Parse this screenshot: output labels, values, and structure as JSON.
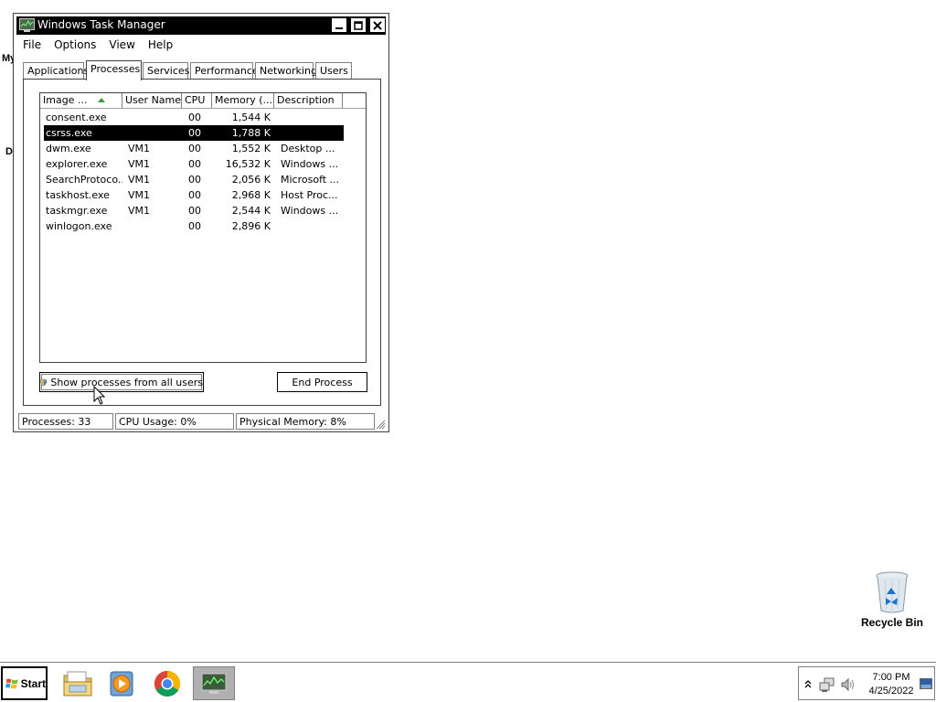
{
  "desktop": {
    "fragments": [
      "My",
      "D"
    ],
    "recycle_bin_label": "Recycle Bin"
  },
  "window": {
    "title": "Windows Task Manager",
    "icon": "task-manager-icon",
    "controls": {
      "minimize": "minimize-icon",
      "maximize": "maximize-icon",
      "close": "close-icon"
    }
  },
  "menu": [
    "File",
    "Options",
    "View",
    "Help"
  ],
  "tabs": [
    "Applications",
    "Processes",
    "Services",
    "Performance",
    "Networking",
    "Users"
  ],
  "active_tab": "Processes",
  "columns": [
    "Image ...",
    "User Name",
    "CPU",
    "Memory (...",
    "Description"
  ],
  "processes": [
    {
      "name": "consent.exe",
      "user": "",
      "cpu": "00",
      "memory": "1,544 K",
      "description": ""
    },
    {
      "name": "csrss.exe",
      "user": "",
      "cpu": "00",
      "memory": "1,788 K",
      "description": ""
    },
    {
      "name": "dwm.exe",
      "user": "VM1",
      "cpu": "00",
      "memory": "1,552 K",
      "description": "Desktop ..."
    },
    {
      "name": "explorer.exe",
      "user": "VM1",
      "cpu": "00",
      "memory": "16,532 K",
      "description": "Windows ..."
    },
    {
      "name": "SearchProtoco...",
      "user": "VM1",
      "cpu": "00",
      "memory": "2,056 K",
      "description": "Microsoft ..."
    },
    {
      "name": "taskhost.exe",
      "user": "VM1",
      "cpu": "00",
      "memory": "2,968 K",
      "description": "Host Proc..."
    },
    {
      "name": "taskmgr.exe",
      "user": "VM1",
      "cpu": "00",
      "memory": "2,544 K",
      "description": "Windows ..."
    },
    {
      "name": "winlogon.exe",
      "user": "",
      "cpu": "00",
      "memory": "2,896 K",
      "description": ""
    }
  ],
  "selected_process": "csrss.exe",
  "buttons": {
    "show_all": "Show processes from all users",
    "end_process": "End Process"
  },
  "status": {
    "processes": "Processes: 33",
    "cpu": "CPU Usage: 0%",
    "memory": "Physical Memory: 8%"
  },
  "taskbar": {
    "start_label": "Start",
    "apps": [
      "file-explorer-icon",
      "media-player-icon",
      "chrome-icon",
      "task-manager-icon"
    ],
    "active_app": "task-manager-icon",
    "time": "7:00 PM",
    "date": "4/25/2022",
    "tray_icons": [
      "show-hidden-icons-chevron",
      "network-icon",
      "volume-icon",
      "show-desktop-icon"
    ]
  },
  "colors": {
    "title_bar": "#000000",
    "selection": "#000000",
    "sort_arrow": "#3a9a3a"
  }
}
